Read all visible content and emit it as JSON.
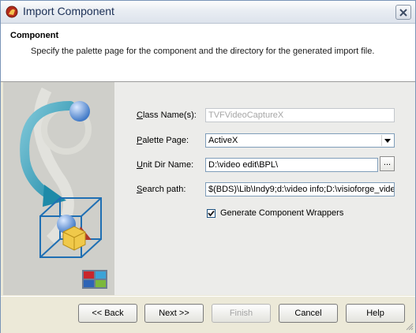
{
  "window": {
    "title": "Import Component"
  },
  "header": {
    "title": "Component",
    "description": "Specify the palette page for the component and the directory for the generated import file."
  },
  "form": {
    "class_name": {
      "label_pre": "",
      "label_key": "C",
      "label_post": "lass Name(s):",
      "value": "TVFVideoCaptureX"
    },
    "palette_page": {
      "label_pre": "",
      "label_key": "P",
      "label_post": "alette Page:",
      "value": "ActiveX"
    },
    "unit_dir": {
      "label_pre": "",
      "label_key": "U",
      "label_post": "nit Dir Name:",
      "value": "D:\\video edit\\BPL\\",
      "browse_label": "..."
    },
    "search_path": {
      "label_pre": "",
      "label_key": "S",
      "label_post": "earch path:",
      "value": "$(BDS)\\Lib\\Indy9;d:\\video info;D:\\visioforge_vide"
    },
    "wrappers": {
      "label": "Generate Component Wrappers",
      "checked": true
    }
  },
  "buttons": {
    "back": "<< Back",
    "next": "Next >>",
    "finish": "Finish",
    "cancel": "Cancel",
    "help": "Help"
  },
  "icons": {
    "app": "delphi-helmet-icon",
    "close": "close-icon",
    "dropdown": "chevron-down-icon",
    "check": "checkmark-icon"
  }
}
